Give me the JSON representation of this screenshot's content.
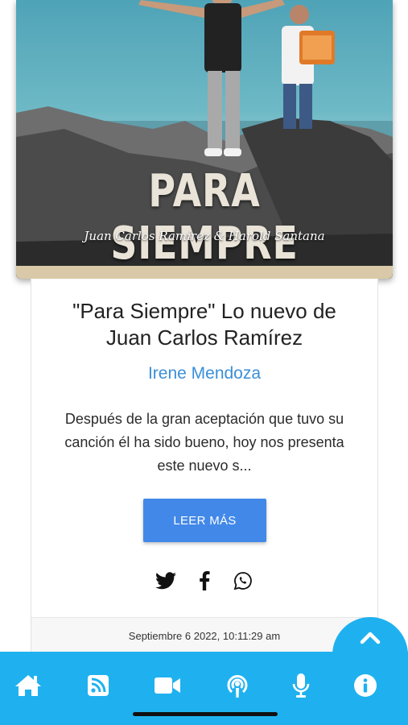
{
  "hero": {
    "title": "PARA SIEMPRE",
    "subtitle": "Juan Carlos Ramírez & Harold Santana"
  },
  "article": {
    "title": "\"Para Siempre\" Lo nuevo de Juan Carlos Ramírez",
    "author": "Irene Mendoza",
    "excerpt": "Después de la gran aceptación que tuvo su canción él ha sido bueno, hoy nos presenta este nuevo s...",
    "read_more_label": "LEER MÁS",
    "date": "Septiembre 6 2022, 10:11:29 am",
    "share_icons": [
      "twitter-icon",
      "facebook-icon",
      "whatsapp-icon"
    ]
  },
  "nav": {
    "items": [
      "home-icon",
      "rss-icon",
      "video-icon",
      "podcast-icon",
      "microphone-icon",
      "info-icon"
    ]
  },
  "colors": {
    "accent": "#1fb1ef",
    "button": "#4288e8",
    "author": "#3a8fd8"
  }
}
